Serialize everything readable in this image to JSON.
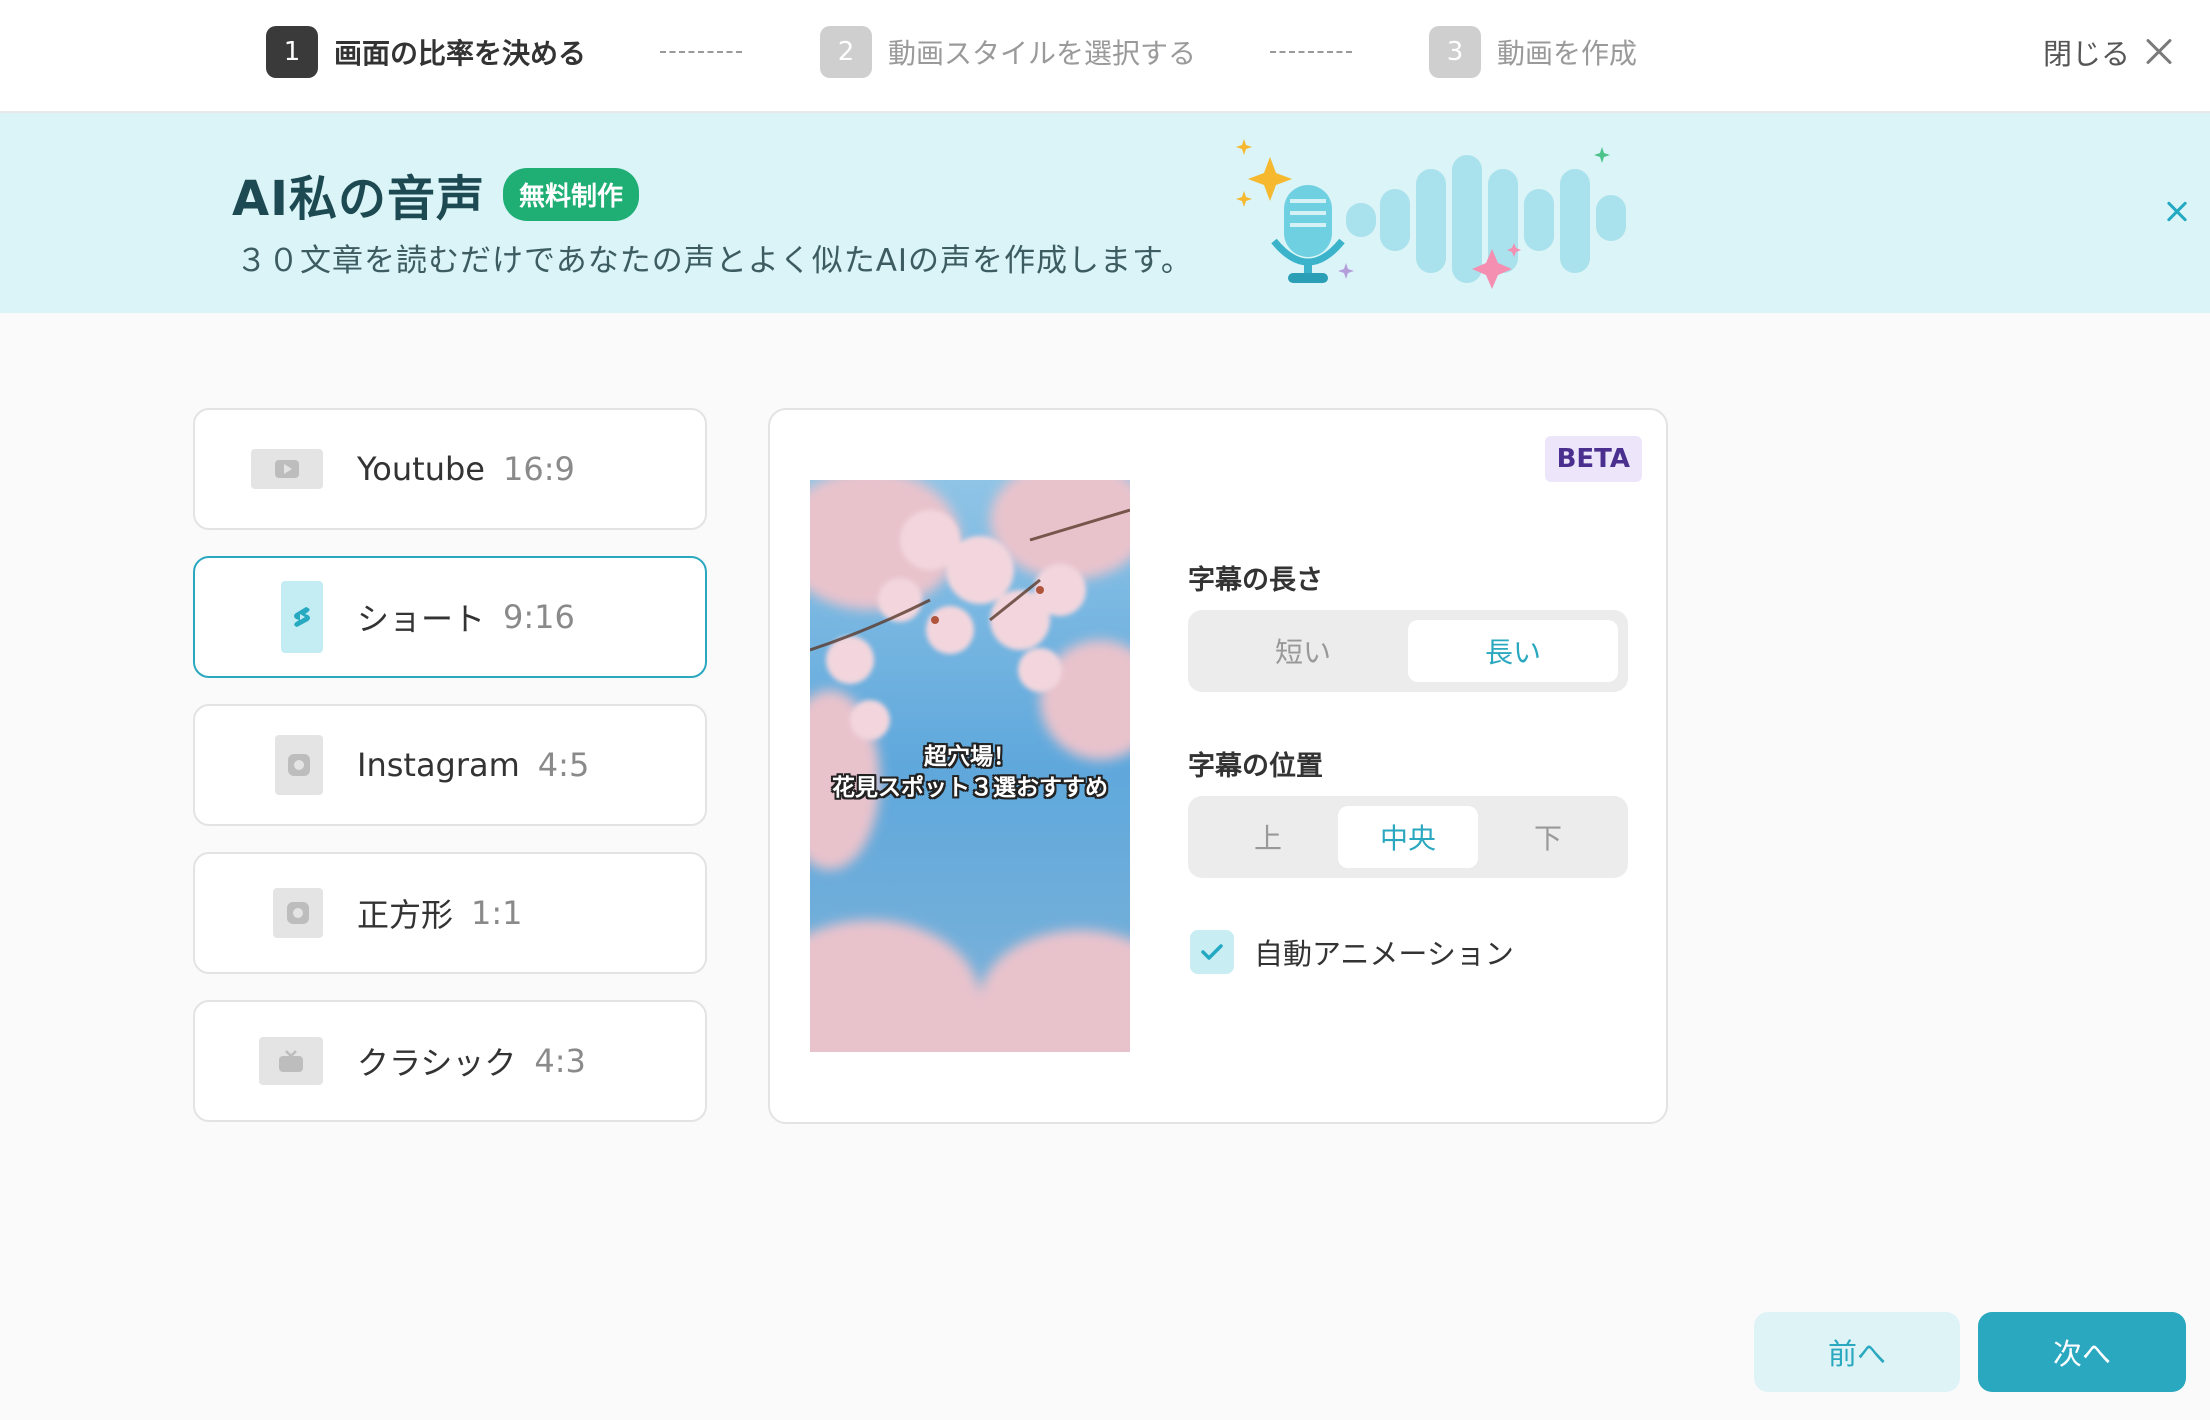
{
  "steps": [
    {
      "num": "1",
      "label": "画面の比率を決める",
      "active": true
    },
    {
      "num": "2",
      "label": "動画スタイルを選択する",
      "active": false
    },
    {
      "num": "3",
      "label": "動画を作成",
      "active": false
    }
  ],
  "close_label": "閉じる",
  "banner": {
    "title": "AI私の音声",
    "badge": "無料制作",
    "subtitle": "３０文章を読むだけであなたの声とよく似たAIの声を作成します。"
  },
  "options": [
    {
      "label": "Youtube",
      "ratio": "16:9",
      "icon": "youtube-icon",
      "selected": false
    },
    {
      "label": "ショート",
      "ratio": "9:16",
      "icon": "shorts-icon",
      "selected": true
    },
    {
      "label": "Instagram",
      "ratio": "4:5",
      "icon": "instagram-icon",
      "selected": false
    },
    {
      "label": "正方形",
      "ratio": "1:1",
      "icon": "square-icon",
      "selected": false
    },
    {
      "label": "クラシック",
      "ratio": "4:3",
      "icon": "tv-icon",
      "selected": false
    }
  ],
  "preview": {
    "beta": "BETA",
    "caption_line1": "超穴場！",
    "caption_line2": "花見スポット３選おすすめ"
  },
  "subtitle_length": {
    "label": "字幕の長さ",
    "options": [
      "短い",
      "長い"
    ],
    "selected": "長い"
  },
  "subtitle_position": {
    "label": "字幕の位置",
    "options": [
      "上",
      "中央",
      "下"
    ],
    "selected": "中央"
  },
  "auto_animation": {
    "label": "自動アニメーション",
    "checked": true
  },
  "buttons": {
    "prev": "前へ",
    "next": "次へ"
  },
  "colors": {
    "accent": "#2aa8c0",
    "banner_bg": "#daf4f7",
    "badge_green": "#1fae74"
  }
}
